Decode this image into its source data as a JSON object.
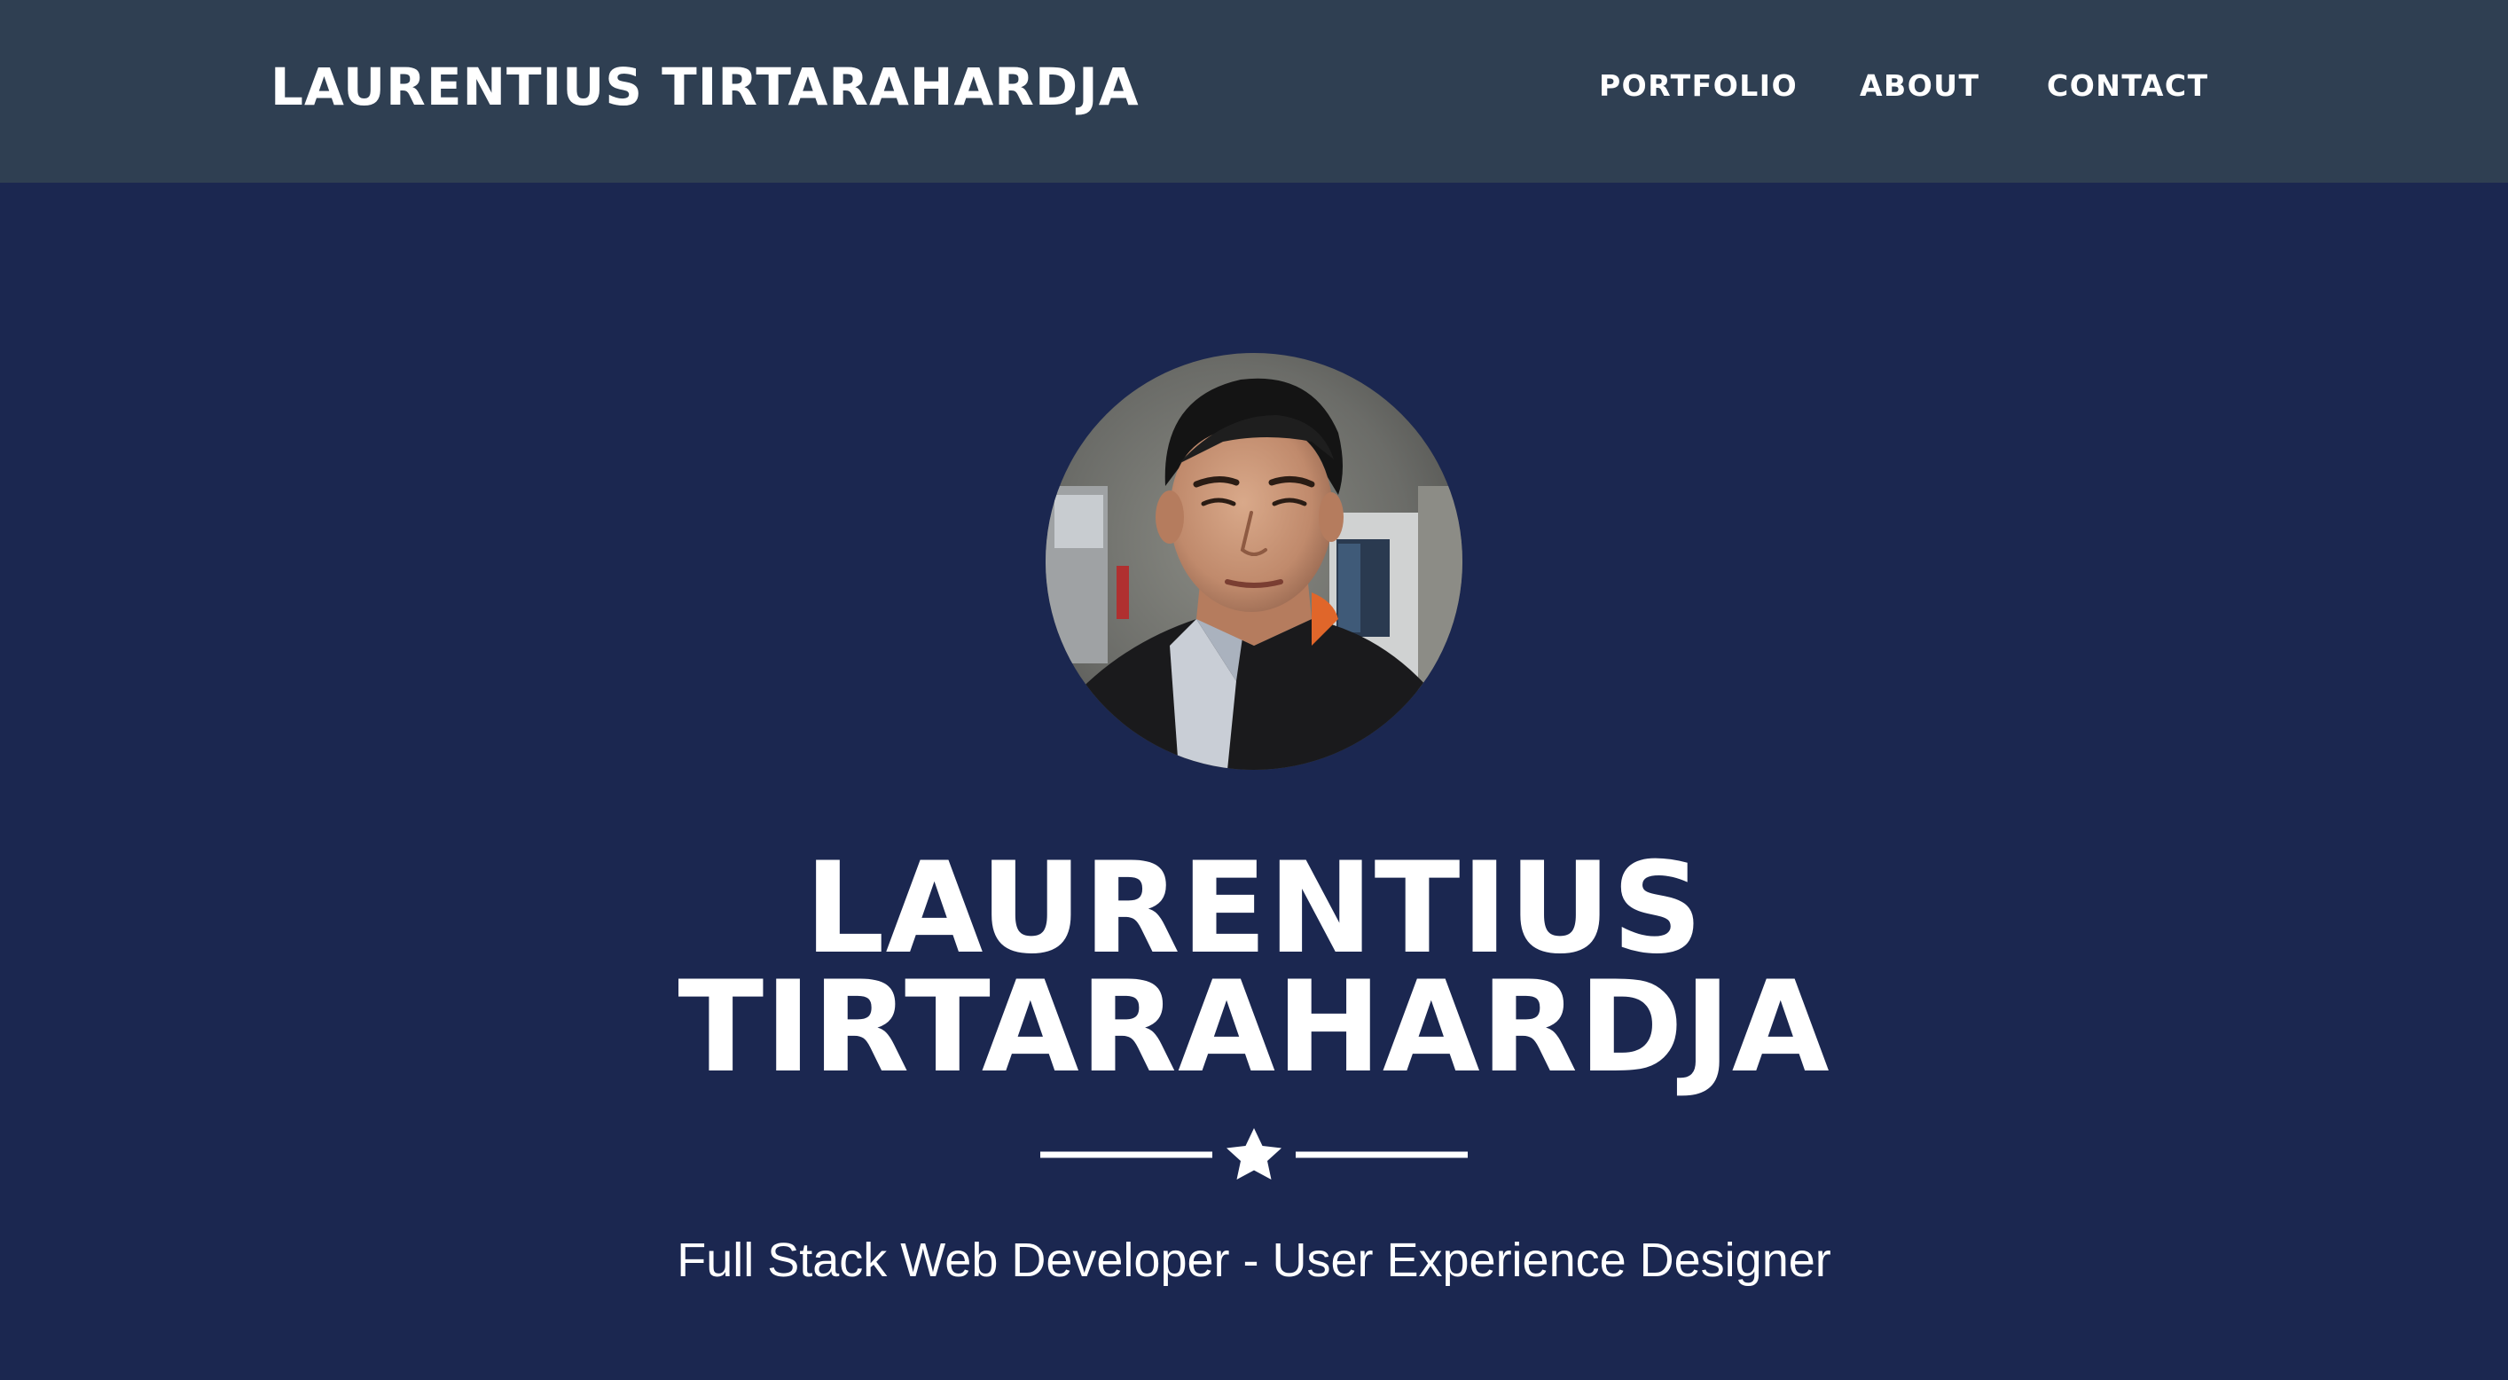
{
  "navbar": {
    "brand": "LAURENTIUS TIRTARAHARDJA",
    "items": [
      {
        "label": "PORTFOLIO"
      },
      {
        "label": "ABOUT"
      },
      {
        "label": "CONTACT"
      }
    ]
  },
  "hero": {
    "title_line1": "LAURENTIUS",
    "title_line2": "TIRTARAHARDJA",
    "divider_icon": "star-icon",
    "subtitle": "Full Stack Web Developer - User Experience Designer"
  },
  "colors": {
    "navbar_bg": "#2f3f52",
    "hero_bg": "#1b2750",
    "text": "#ffffff"
  }
}
